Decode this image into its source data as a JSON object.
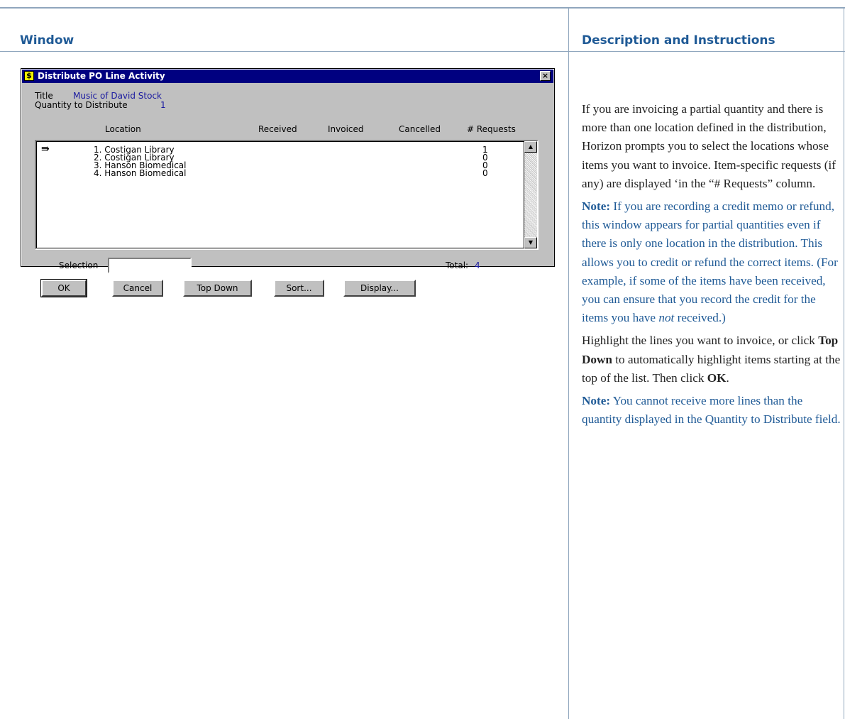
{
  "table": {
    "headers": {
      "window": "Window",
      "description": "Description and Instructions"
    }
  },
  "dialog": {
    "title": "Distribute PO Line Activity",
    "icon": "dollar-icon",
    "close_label": "×",
    "title_label": "Title",
    "title_value": "Music of David Stock",
    "quantity_label": "Quantity to Distribute",
    "quantity_value": "1",
    "columns": [
      "Location",
      "Received",
      "Invoiced",
      "Cancelled",
      "# Requests"
    ],
    "rows": [
      {
        "location": "1. Costigan Library",
        "requests": "1",
        "current": true
      },
      {
        "location": "2. Costigan Library",
        "requests": "0",
        "current": false
      },
      {
        "location": "3. Hanson Biomedical",
        "requests": "0",
        "current": false
      },
      {
        "location": "4. Hanson Biomedical",
        "requests": "0",
        "current": false
      }
    ],
    "selection_label": "Selection",
    "selection_value": "",
    "total_label": "Total:",
    "total_value": "4",
    "buttons": {
      "ok": "OK",
      "cancel": "Cancel",
      "top_down": "Top Down",
      "sort": "Sort...",
      "display": "Display..."
    }
  },
  "description": {
    "p1": "If you are invoicing a partial quantity and there is more than one location defined in the distribution, Horizon prompts you to select the locations whose items you want to invoice. Item-specific requests (if any) are displayed ‘in the “# Requests” column.",
    "note1_label": "Note:",
    "note1_a": " If you are recording a credit memo or refund, this window appears for partial quantities even if there is only one location in the distribution. This allows you to credit or refund the correct items. (For example, if some of the items have been received, you can ensure that you record the credit for the items you have ",
    "note1_em": "not",
    "note1_b": " received.)",
    "p2_a": "Highlight the lines you want to invoice, or click ",
    "p2_bold1": "Top Down",
    "p2_b": " to automatically highlight items starting at the top of the list. Then click ",
    "p2_bold2": "OK",
    "p2_c": ".",
    "note2_label": "Note:",
    "note2_text": " You cannot receive more lines than the quantity displayed in the Quantity to Distribute field."
  },
  "colors": {
    "heading": "#1f5a96",
    "note_text": "#1f5a96",
    "border": "#8fa6bd",
    "titlebar": "#000080"
  }
}
